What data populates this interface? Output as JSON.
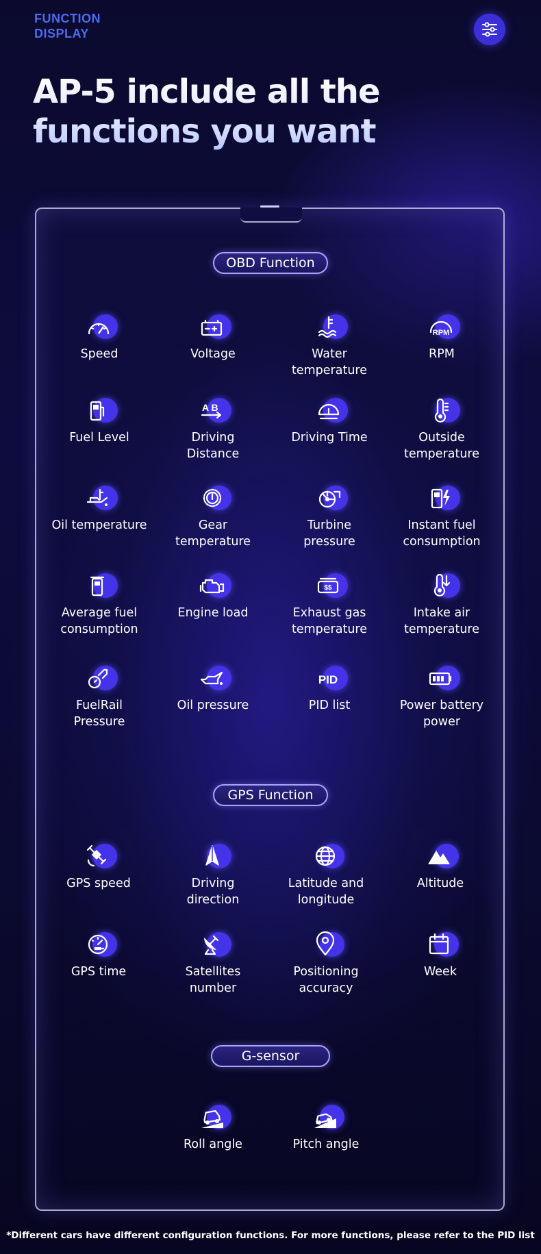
{
  "header": {
    "tag_line1": "FUNCTION",
    "tag_line2": "DISPLAY",
    "title_line1": "AP-5 include all the",
    "title_line2": "functions you want",
    "menu_icon": "sliders-icon"
  },
  "sections": {
    "obd": "OBD Function",
    "gps": "GPS Function",
    "gsensor": "G-sensor"
  },
  "obd_items": [
    {
      "l1": "Speed",
      "l2": "",
      "icon": "speedometer-icon"
    },
    {
      "l1": "Voltage",
      "l2": "",
      "icon": "battery-icon"
    },
    {
      "l1": "Water",
      "l2": "temperature",
      "icon": "coolant-temperature-icon"
    },
    {
      "l1": "RPM",
      "l2": "",
      "icon": "rpm-gauge-icon"
    },
    {
      "l1": "Fuel Level",
      "l2": "",
      "icon": "fuel-pump-icon"
    },
    {
      "l1": "Driving",
      "l2": "Distance",
      "icon": "distance-icon"
    },
    {
      "l1": "Driving Time",
      "l2": "",
      "icon": "driving-time-icon"
    },
    {
      "l1": "Outside",
      "l2": "temperature",
      "icon": "thermometer-icon"
    },
    {
      "l1": "Oil temperature",
      "l2": "",
      "icon": "oil-temperature-icon"
    },
    {
      "l1": "Gear",
      "l2": "temperature",
      "icon": "gear-temperature-icon"
    },
    {
      "l1": "Turbine",
      "l2": "pressure",
      "icon": "turbo-icon"
    },
    {
      "l1": "Instant fuel",
      "l2": "consumption",
      "icon": "instant-fuel-icon"
    },
    {
      "l1": "Average fuel",
      "l2": "consumption",
      "icon": "average-fuel-icon"
    },
    {
      "l1": "Engine load",
      "l2": "",
      "icon": "engine-icon"
    },
    {
      "l1": "Exhaust gas",
      "l2": "temperature",
      "icon": "exhaust-icon"
    },
    {
      "l1": "Intake air",
      "l2": "temperature",
      "icon": "intake-air-icon"
    },
    {
      "l1": "FuelRail",
      "l2": "Pressure",
      "icon": "fuel-rail-icon"
    },
    {
      "l1": "Oil pressure",
      "l2": "",
      "icon": "oil-can-icon"
    },
    {
      "l1": "PID list",
      "l2": "",
      "icon": "pid-icon"
    },
    {
      "l1": "Power battery",
      "l2": "power",
      "icon": "battery-level-icon"
    }
  ],
  "gps_items": [
    {
      "l1": "GPS speed",
      "l2": "",
      "icon": "satellite-icon"
    },
    {
      "l1": "Driving",
      "l2": "direction",
      "icon": "direction-arrow-icon"
    },
    {
      "l1": "Latitude and",
      "l2": "longitude",
      "icon": "globe-icon"
    },
    {
      "l1": "Altitude",
      "l2": "",
      "icon": "mountain-icon"
    },
    {
      "l1": "GPS time",
      "l2": "",
      "icon": "clock-gauge-icon"
    },
    {
      "l1": "Satellites",
      "l2": "number",
      "icon": "satellite-dish-icon"
    },
    {
      "l1": "Positioning",
      "l2": "accuracy",
      "icon": "location-pin-icon"
    },
    {
      "l1": "Week",
      "l2": "",
      "icon": "calendar-icon"
    }
  ],
  "gsensor_items": [
    {
      "l1": "Roll angle",
      "l2": "",
      "icon": "roll-car-icon"
    },
    {
      "l1": "Pitch angle",
      "l2": "",
      "icon": "pitch-car-icon"
    }
  ],
  "footnote": "*Different cars have different configuration functions. For more functions, please refer to the PID list",
  "colors": {
    "accent": "#4433e8",
    "tag": "#4c6cf0",
    "background": "#0b0a2e"
  }
}
